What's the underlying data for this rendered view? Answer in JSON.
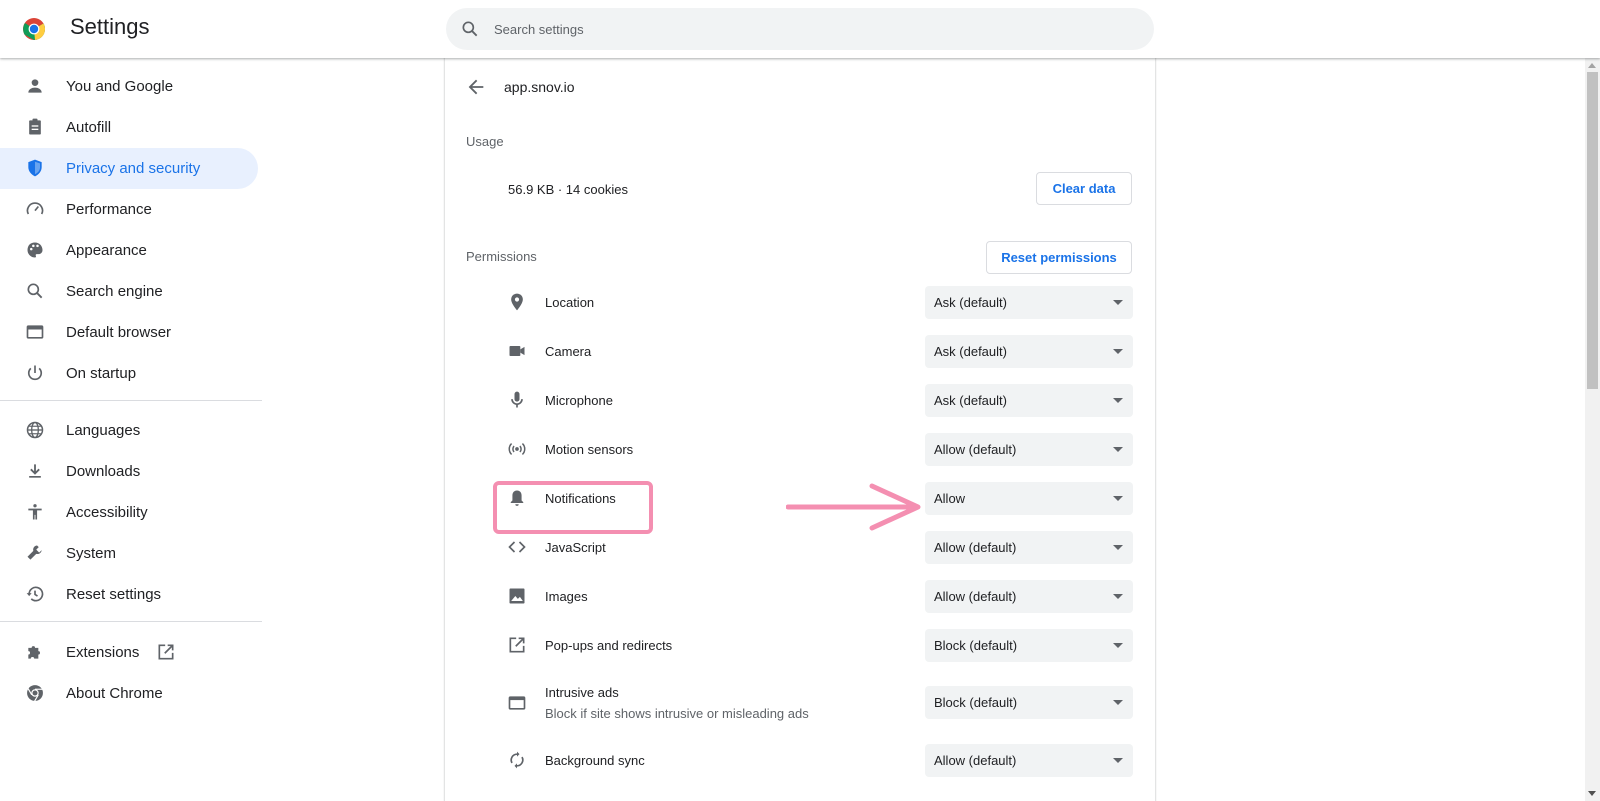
{
  "header": {
    "title": "Settings",
    "search_placeholder": "Search settings",
    "logo_icon": "chrome-logo-icon"
  },
  "sidebar": {
    "active_color": "#1a73e8",
    "items": [
      {
        "label": "You and Google",
        "icon": "person-icon"
      },
      {
        "label": "Autofill",
        "icon": "clipboard-icon"
      },
      {
        "label": "Privacy and security",
        "icon": "shield-icon",
        "active": true
      },
      {
        "label": "Performance",
        "icon": "speedometer-icon"
      },
      {
        "label": "Appearance",
        "icon": "palette-icon"
      },
      {
        "label": "Search engine",
        "icon": "search-icon"
      },
      {
        "label": "Default browser",
        "icon": "browser-window-icon"
      },
      {
        "label": "On startup",
        "icon": "power-icon"
      },
      {
        "label": "Languages",
        "icon": "globe-icon"
      },
      {
        "label": "Downloads",
        "icon": "download-icon"
      },
      {
        "label": "Accessibility",
        "icon": "accessibility-icon"
      },
      {
        "label": "System",
        "icon": "wrench-icon"
      },
      {
        "label": "Reset settings",
        "icon": "history-icon"
      },
      {
        "label": "Extensions",
        "icon": "puzzle-icon"
      },
      {
        "label": "About Chrome",
        "icon": "chrome-icon"
      }
    ]
  },
  "site": {
    "name": "app.snov.io",
    "usage_title": "Usage",
    "usage_text": "56.9 KB · 14 cookies",
    "clear_data_label": "Clear data",
    "permissions_title": "Permissions",
    "reset_permissions_label": "Reset permissions"
  },
  "permissions": [
    {
      "label": "Location",
      "value": "Ask (default)",
      "icon": "location-pin-icon"
    },
    {
      "label": "Camera",
      "value": "Ask (default)",
      "icon": "camera-icon"
    },
    {
      "label": "Microphone",
      "value": "Ask (default)",
      "icon": "microphone-icon"
    },
    {
      "label": "Motion sensors",
      "value": "Allow (default)",
      "icon": "sensors-icon"
    },
    {
      "label": "Notifications",
      "value": "Allow",
      "icon": "bell-icon"
    },
    {
      "label": "JavaScript",
      "value": "Allow (default)",
      "icon": "code-icon"
    },
    {
      "label": "Images",
      "value": "Allow (default)",
      "icon": "image-icon"
    },
    {
      "label": "Pop-ups and redirects",
      "value": "Block (default)",
      "icon": "open-in-new-icon"
    },
    {
      "label": "Intrusive ads",
      "sublabel": "Block if site shows intrusive or misleading ads",
      "value": "Block (default)",
      "icon": "ads-window-icon"
    },
    {
      "label": "Background sync",
      "value": "Allow (default)",
      "icon": "sync-icon"
    }
  ],
  "annotation": {
    "highlight_color": "#f48fb1",
    "arrow_icon": "annotation-arrow-icon"
  }
}
